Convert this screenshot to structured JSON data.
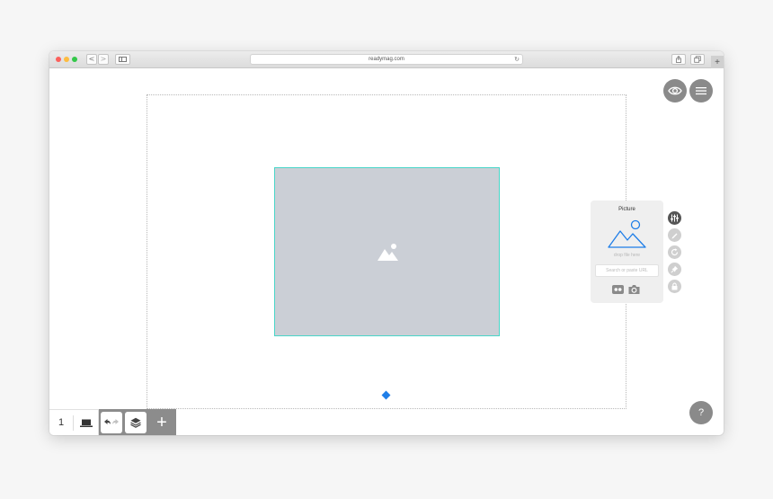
{
  "browser": {
    "url": "readymag.com",
    "reload_icon": "reload-icon",
    "back_glyph": "<",
    "forward_glyph": ">",
    "new_tab_glyph": "+"
  },
  "editor": {
    "widget_icon": "image-placeholder-icon",
    "anchor_color": "#1f7ee8",
    "selection_color": "#49d6c8"
  },
  "right_buttons": {
    "preview_icon": "eye-icon",
    "menu_icon": "hamburger-icon",
    "help_label": "?"
  },
  "picture_panel": {
    "title": "Picture",
    "drop_hint": "drop file here",
    "search_placeholder": "Search or paste URL",
    "sources": [
      "flickr-icon",
      "camera-icon"
    ]
  },
  "side_tools": [
    "sliders-icon",
    "pen-icon",
    "rotate-icon",
    "pin-icon",
    "lock-icon"
  ],
  "bottom_toolbar": {
    "page_number": "1",
    "device_icon": "laptop-icon",
    "add_label": "+"
  }
}
